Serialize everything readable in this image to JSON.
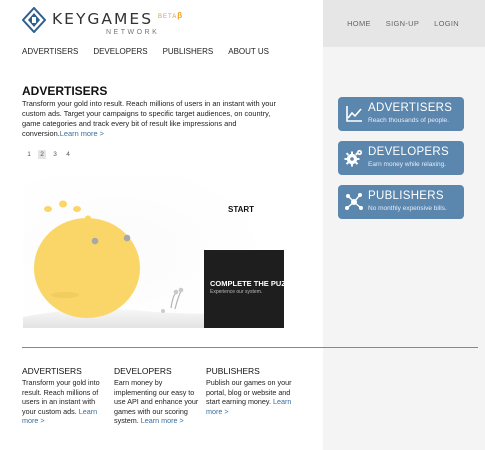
{
  "brand": {
    "name": "KEYGAMES",
    "subtitle": "NETWORK",
    "beta_text": "BETA",
    "beta_glyph": "β"
  },
  "top_nav": [
    "HOME",
    "SIGN-UP",
    "LOGIN"
  ],
  "main_nav": [
    "ADVERTISERS",
    "DEVELOPERS",
    "PUBLISHERS",
    "ABOUT US"
  ],
  "intro": {
    "title": "ADVERTISERS",
    "text": "Transform your gold into result. Reach millions of users in an instant with your custom ads. Target your campaigns to specific target audiences, on country, game categories and track every bit of result like impressions and conversion.",
    "link": "Learn more >"
  },
  "pager": {
    "pages": [
      "1",
      "2",
      "3",
      "4"
    ],
    "active": "2"
  },
  "game": {
    "start_label": "START",
    "panel_title": "COMPLETE THE PUZZLE",
    "panel_subtitle": "Experience our system."
  },
  "side_buttons": [
    {
      "title": "ADVERTISERS",
      "subtitle": "Reach thousands of people.",
      "icon": "chart-icon"
    },
    {
      "title": "DEVELOPERS",
      "subtitle": "Earn money while relaxing.",
      "icon": "gear-icon"
    },
    {
      "title": "PUBLISHERS",
      "subtitle": "No monthly expensive bills.",
      "icon": "network-icon"
    }
  ],
  "columns": [
    {
      "title": "ADVERTISERS",
      "text": "Transform your gold into result. Reach millions of users in an instant with your custom ads.",
      "link": "Learn more >"
    },
    {
      "title": "DEVELOPERS",
      "text": "Earn money by implementing our easy to use API and enhance your games with our scoring system.",
      "link": "Learn more >"
    },
    {
      "title": "PUBLISHERS",
      "text": "Publish our games on your portal, blog or website and start earning money.",
      "link": "Learn more >"
    }
  ],
  "colors": {
    "accent": "#5b86ad",
    "link": "#3a6c9e",
    "mascot": "#fad668",
    "beta": "#f0a020"
  }
}
